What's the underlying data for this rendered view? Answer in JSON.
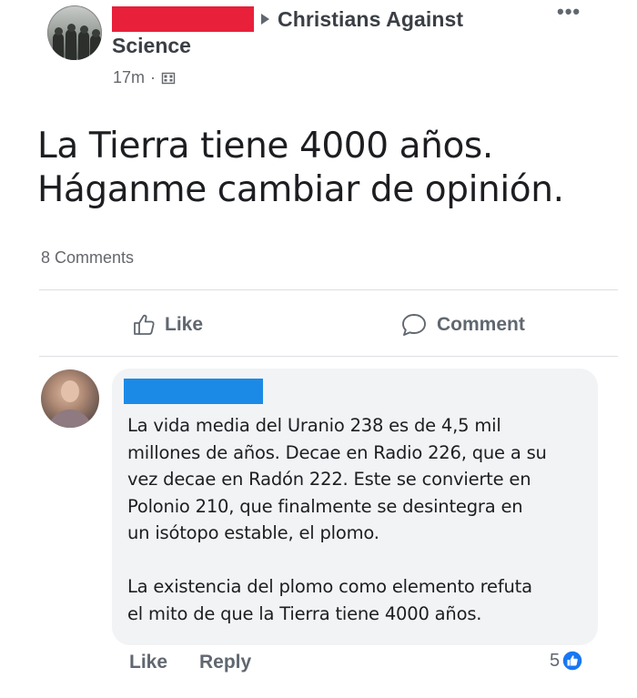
{
  "post": {
    "author_redacted": true,
    "group_name_line1": "Christians Against",
    "group_name_line2": "Science",
    "timestamp": "17m",
    "separator": "·",
    "audience_icon": "group-audience-icon",
    "more_icon": "more-options-icon",
    "more_glyph": "•••",
    "body_lines": [
      "La Tierra tiene 4000 años.",
      "Háganme cambiar de opinión."
    ],
    "comment_count": "8 Comments"
  },
  "actions": {
    "like_label": "Like",
    "comment_label": "Comment",
    "like_icon": "thumbs-up-icon",
    "comment_icon": "speech-bubble-icon"
  },
  "comment": {
    "author_redacted": true,
    "paragraph1_lines": [
      "La vida media del Uranio 238 es de 4,5 mil",
      "millones de años. Decae en Radio 226, que a su",
      "vez decae en Radón 222. Este se convierte en",
      "Polonio 210, que finalmente se desintegra en",
      "un isótopo estable, el plomo."
    ],
    "paragraph2_lines": [
      "La existencia del plomo como elemento refuta",
      "el mito de que la Tierra tiene 4000 años."
    ],
    "like_label": "Like",
    "reply_label": "Reply",
    "reaction_count": "5",
    "reaction_icon": "like-reaction-icon"
  },
  "colors": {
    "redaction_red": "#e8203a",
    "redaction_blue": "#1b8ae6",
    "reaction_blue": "#1877f2"
  }
}
